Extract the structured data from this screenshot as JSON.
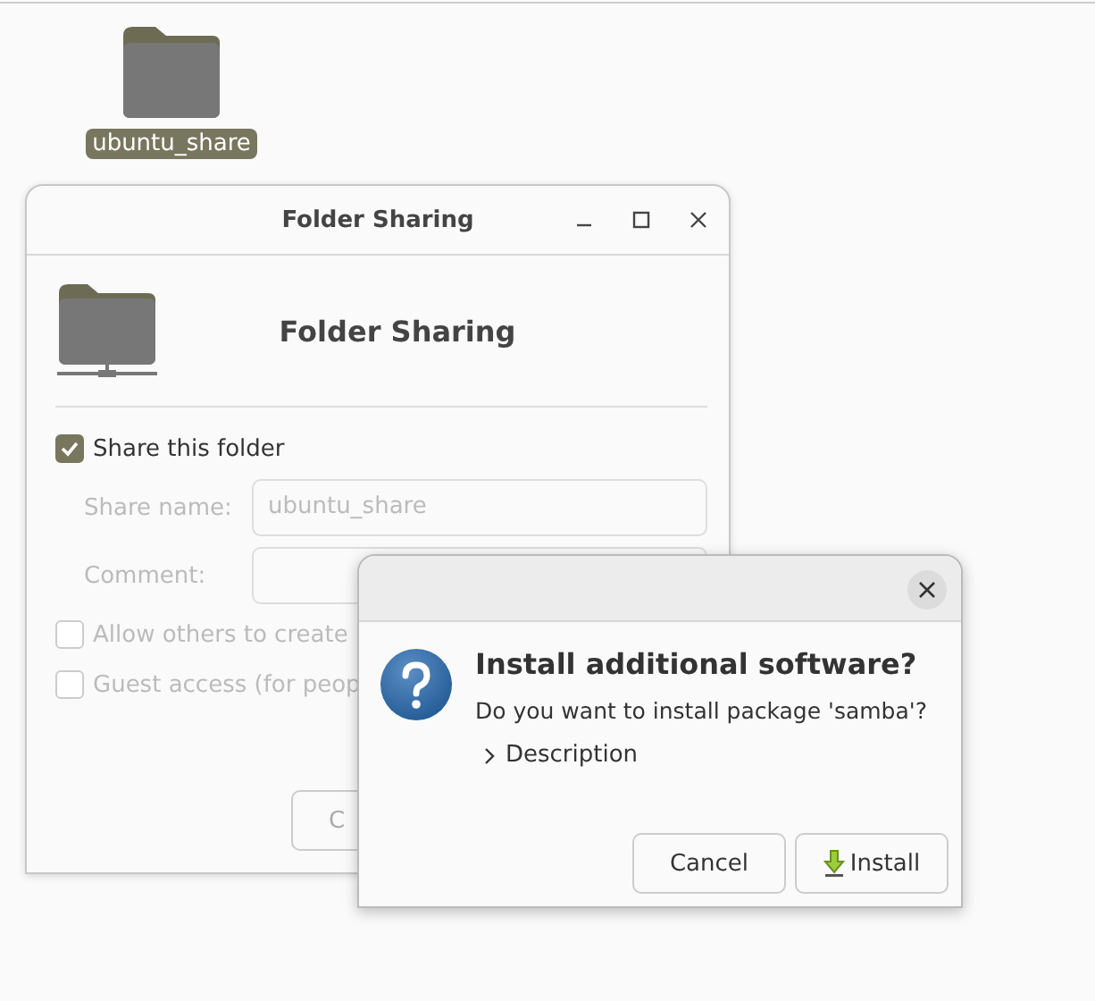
{
  "desktop_icon": {
    "label": "ubuntu_share",
    "selected": true
  },
  "folder_window": {
    "title": "Folder Sharing",
    "heading": "Folder Sharing",
    "share": {
      "label": "Share this folder",
      "checked": true
    },
    "share_name": {
      "label": "Share name:",
      "value": "ubuntu_share"
    },
    "comment": {
      "label": "Comment:"
    },
    "options": [
      {
        "label": "Allow others to create",
        "checked": false
      },
      {
        "label": "Guest access (for peop",
        "checked": false
      }
    ],
    "button": "C"
  },
  "dialog": {
    "title": "Install additional software?",
    "message": "Do you want to install package 'samba'?",
    "expander": {
      "label": "Description",
      "expanded": false
    },
    "buttons": [
      {
        "label": "Cancel",
        "kind": "plain"
      },
      {
        "label": "Install",
        "kind": "install"
      }
    ]
  }
}
